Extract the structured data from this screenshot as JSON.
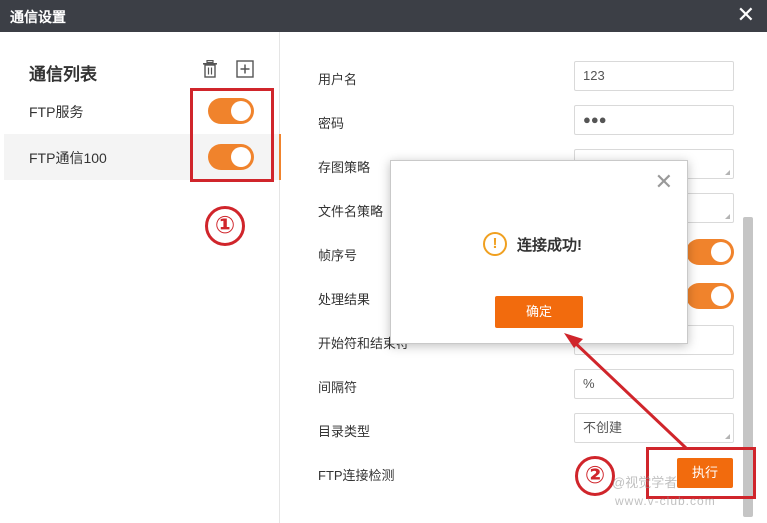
{
  "window": {
    "title": "通信设置"
  },
  "sidebar": {
    "title": "通信列表",
    "items": [
      {
        "label": "FTP服务",
        "enabled": true
      },
      {
        "label": "FTP通信100",
        "enabled": true
      }
    ]
  },
  "form": {
    "username": {
      "label": "用户名",
      "value": "123"
    },
    "password": {
      "label": "密码",
      "value": "●●●"
    },
    "save_strategy": {
      "label": "存图策略"
    },
    "filename_strategy": {
      "label": "文件名策略"
    },
    "frame_number": {
      "label": "帧序号",
      "enabled": true
    },
    "process_result": {
      "label": "处理结果",
      "enabled": true
    },
    "start_end_char": {
      "label": "开始符和结束符"
    },
    "separator": {
      "label": "间隔符",
      "value": "%"
    },
    "dir_type": {
      "label": "目录类型",
      "value": "不创建"
    },
    "ftp_check": {
      "label": "FTP连接检测",
      "button": "执行"
    }
  },
  "dialog": {
    "message": "连接成功!",
    "ok_label": "确定"
  },
  "annotations": {
    "one": "①",
    "two": "②"
  },
  "watermark": {
    "line1": "@视觉学者",
    "line2": "www.v-club.com"
  },
  "colors": {
    "accent": "#f26b0d",
    "toggle": "#f0832c",
    "annotation": "#d0252b",
    "titlebar": "#3c3f46"
  }
}
